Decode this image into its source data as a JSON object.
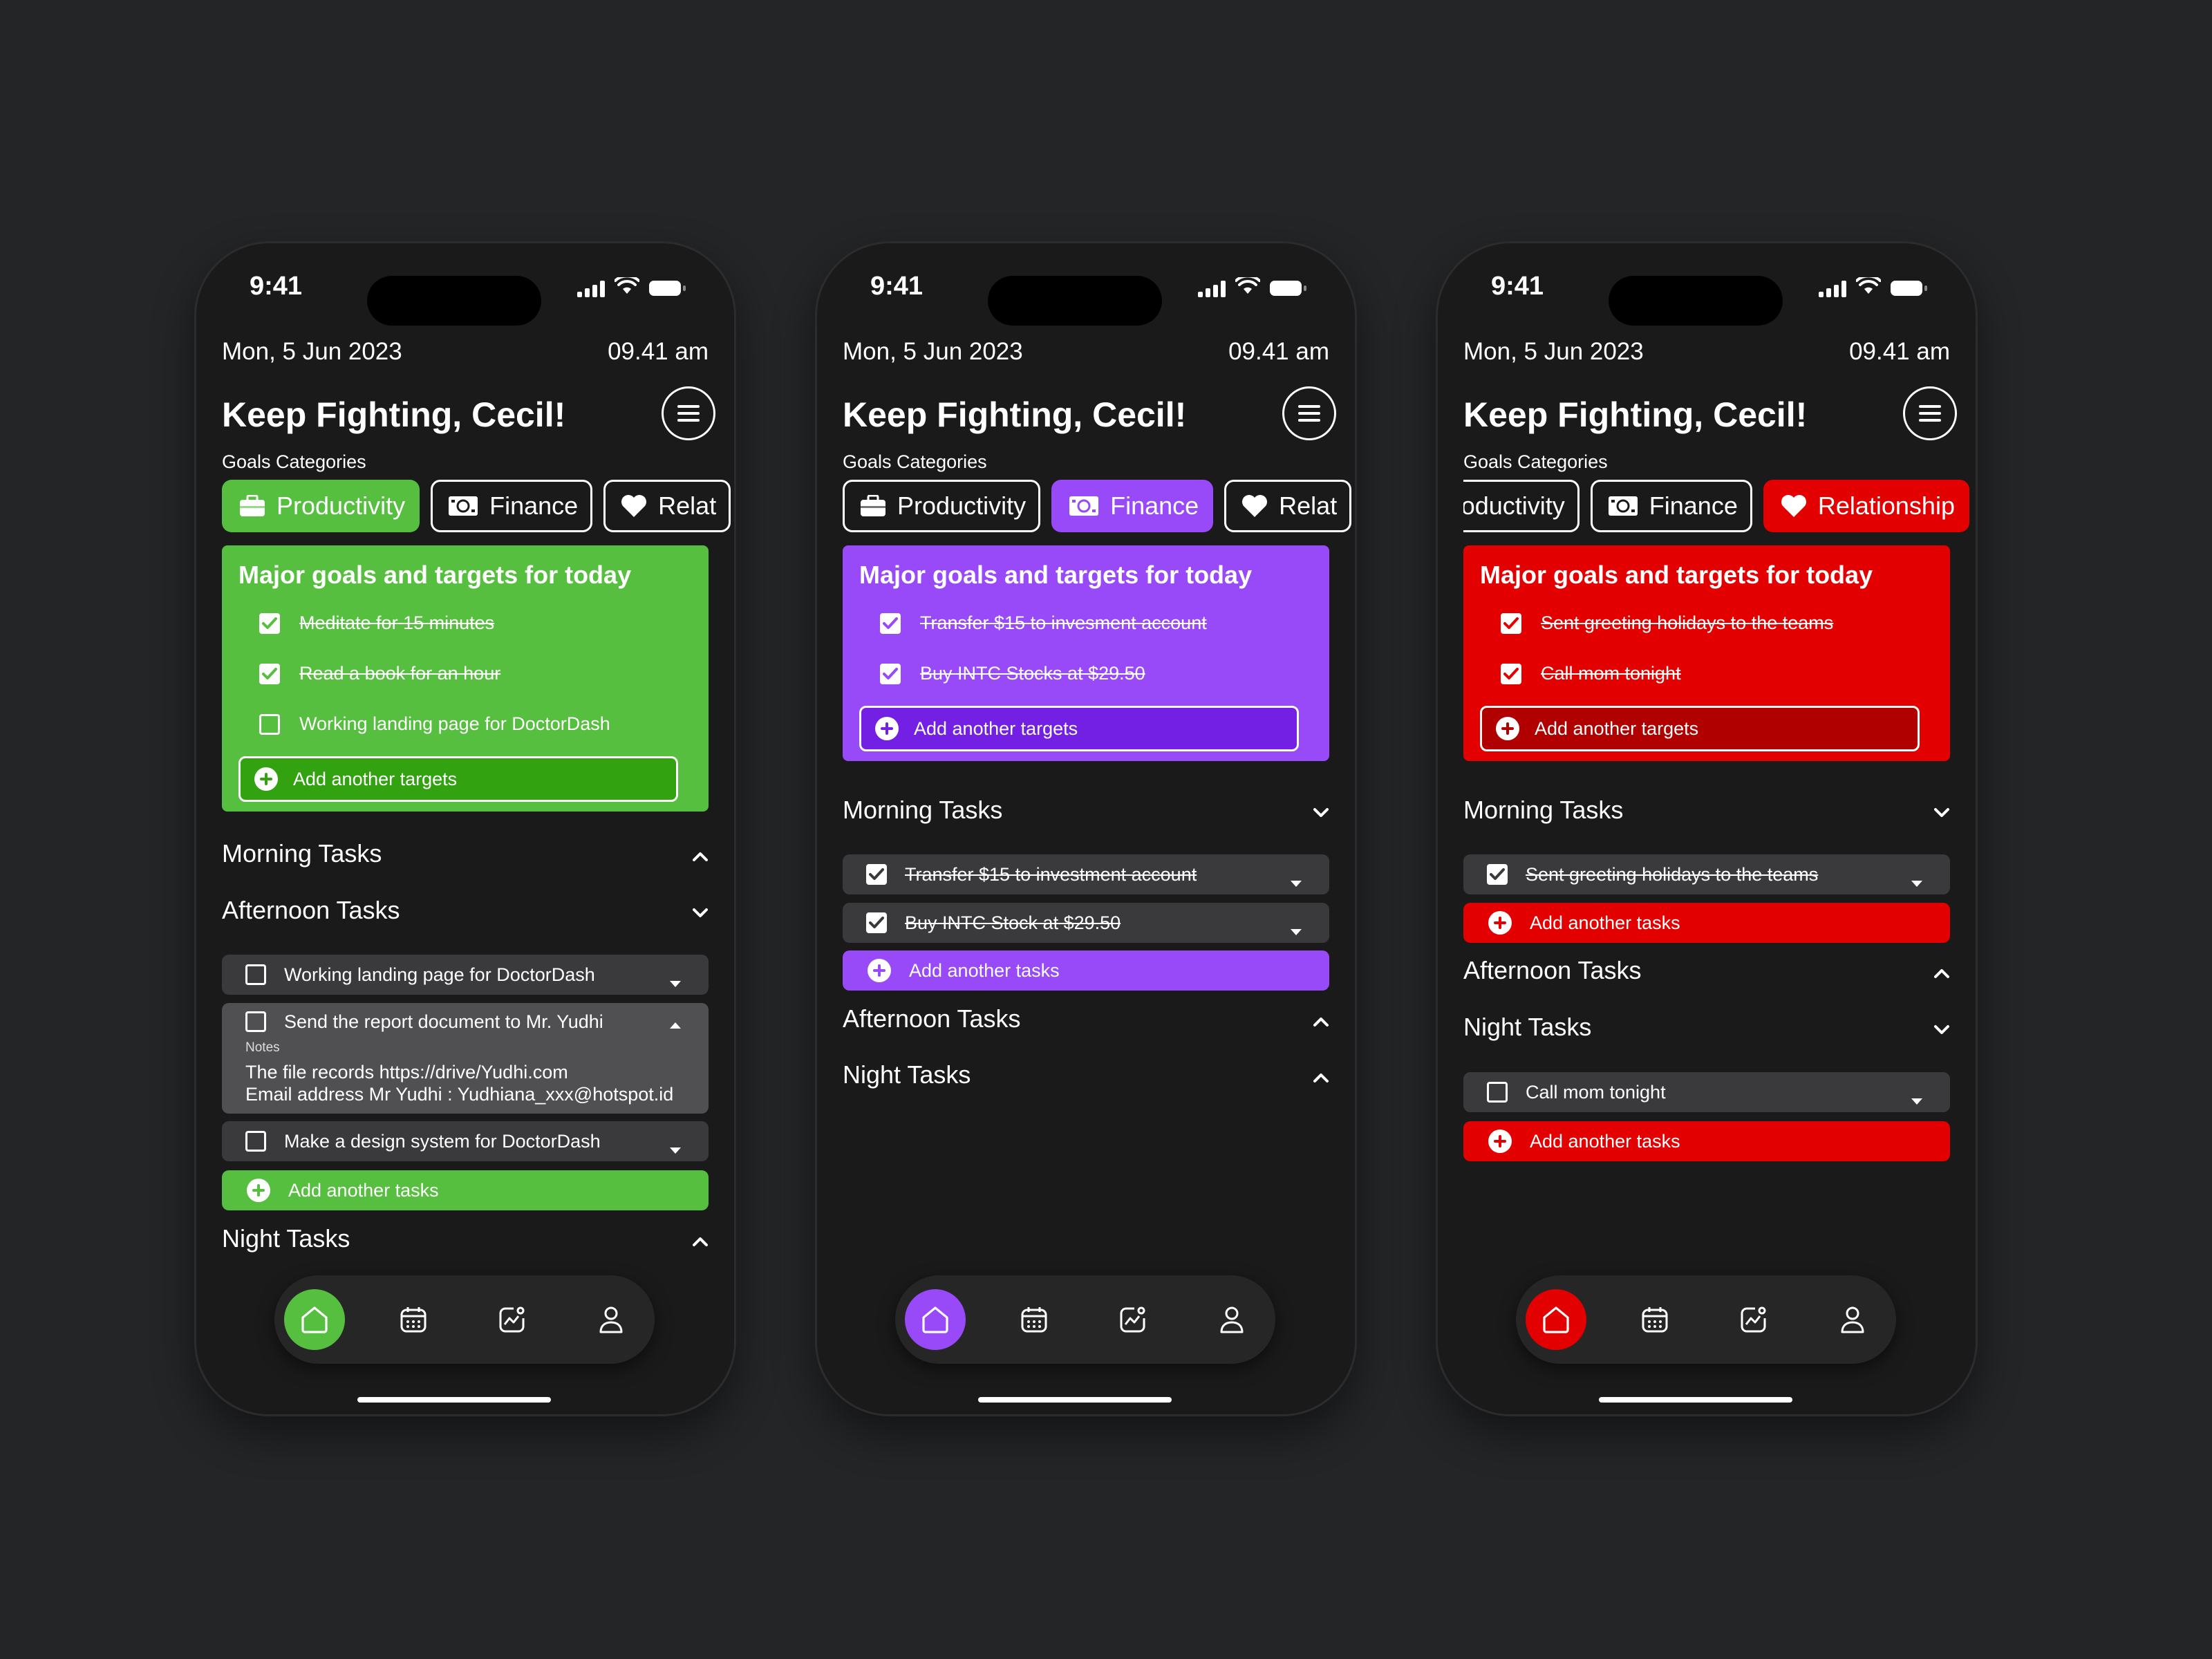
{
  "colors": {
    "productivity": "#56bf3f",
    "finance": "#9849f8",
    "relationship": "#e20000",
    "background": "#242527"
  },
  "phones": [
    {
      "theme": "productivity",
      "status_time": "9:41",
      "date": "Mon, 5 Jun 2023",
      "clock": "09.41 am",
      "greeting": "Keep Fighting, Cecil!",
      "categories_label": "Goals Categories",
      "categories": [
        {
          "label": "Productivity",
          "icon": "briefcase-icon"
        },
        {
          "label": "Finance",
          "icon": "money-icon"
        },
        {
          "label": "Relat",
          "icon": "heart-icon"
        }
      ],
      "goals_title": "Major goals and targets for today",
      "goals": [
        {
          "text": "Meditate for 15 minutes",
          "done": true
        },
        {
          "text": "Read a book for an hour",
          "done": true
        },
        {
          "text": "Working landing page for DoctorDash",
          "done": false
        }
      ],
      "add_target": "Add another targets",
      "sections": {
        "morning": "Morning Tasks",
        "afternoon": "Afternoon Tasks",
        "night": "Night Tasks"
      },
      "afternoon_tasks": [
        {
          "text": "Working landing page for DoctorDash",
          "done": false
        },
        {
          "text": "Send the report document to Mr. Yudhi",
          "done": false,
          "notes_label": "Notes",
          "notes": "The file records https://drive/Yudhi.com\nEmail address Mr Yudhi : Yudhiana_xxx@hotspot.id"
        },
        {
          "text": "Make a design system for DoctorDash",
          "done": false
        }
      ],
      "add_task": "Add another tasks"
    },
    {
      "theme": "finance",
      "status_time": "9:41",
      "date": "Mon, 5 Jun 2023",
      "clock": "09.41 am",
      "greeting": "Keep Fighting, Cecil!",
      "categories_label": "Goals Categories",
      "categories": [
        {
          "label": "Productivity",
          "icon": "briefcase-icon"
        },
        {
          "label": "Finance",
          "icon": "money-icon"
        },
        {
          "label": "Relat",
          "icon": "heart-icon"
        }
      ],
      "goals_title": "Major goals and targets for today",
      "goals": [
        {
          "text": "Transfer $15 to invesment account",
          "done": true
        },
        {
          "text": "Buy INTC Stocks at $29.50",
          "done": true
        }
      ],
      "add_target": "Add another targets",
      "sections": {
        "morning": "Morning Tasks",
        "afternoon": "Afternoon Tasks",
        "night": "Night Tasks"
      },
      "morning_tasks": [
        {
          "text": "Transfer $15 to investment account",
          "done": true
        },
        {
          "text": "Buy INTC Stock at $29.50",
          "done": true
        }
      ],
      "add_task": "Add another tasks"
    },
    {
      "theme": "relationship",
      "status_time": "9:41",
      "date": "Mon, 5 Jun 2023",
      "clock": "09.41 am",
      "greeting": "Keep Fighting, Cecil!",
      "categories_label": "Goals Categories",
      "categories": [
        {
          "label": "Productivity",
          "icon": "briefcase-icon"
        },
        {
          "label": "Finance",
          "icon": "money-icon"
        },
        {
          "label": "Relationship",
          "icon": "heart-icon"
        }
      ],
      "goals_title": "Major goals and targets for today",
      "goals": [
        {
          "text": "Sent greeting holidays to the teams",
          "done": true
        },
        {
          "text": "Call mom tonight",
          "done": true
        }
      ],
      "add_target": "Add another targets",
      "sections": {
        "morning": "Morning Tasks",
        "afternoon": "Afternoon Tasks",
        "night": "Night Tasks"
      },
      "morning_tasks": [
        {
          "text": "Sent greeting holidays to the teams",
          "done": true
        }
      ],
      "night_tasks": [
        {
          "text": "Call mom tonight",
          "done": false
        }
      ],
      "add_task": "Add another tasks"
    }
  ],
  "nav": [
    {
      "icon": "home-icon",
      "active": true
    },
    {
      "icon": "calendar-icon",
      "active": false
    },
    {
      "icon": "chart-icon",
      "active": false
    },
    {
      "icon": "profile-icon",
      "active": false
    }
  ]
}
